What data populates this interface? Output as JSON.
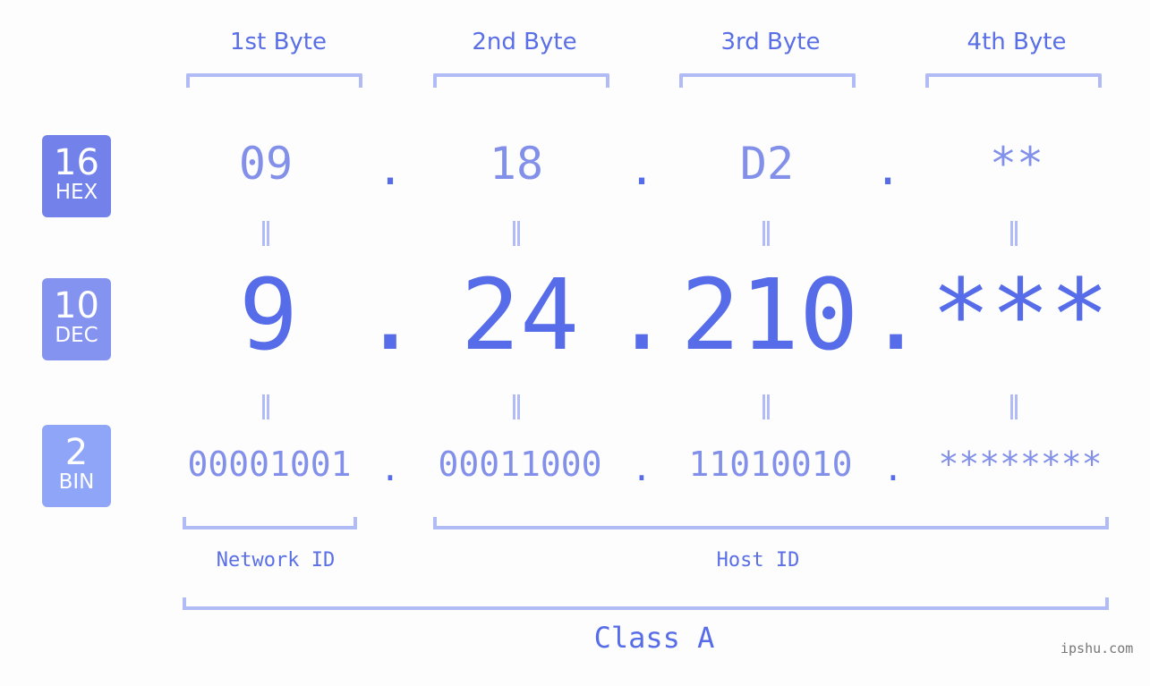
{
  "bytes": [
    {
      "label": "1st Byte",
      "hex": "09",
      "dec": "9",
      "bin": "00001001"
    },
    {
      "label": "2nd Byte",
      "hex": "18",
      "dec": "24",
      "bin": "00011000"
    },
    {
      "label": "3rd Byte",
      "hex": "D2",
      "dec": "210",
      "bin": "11010010"
    },
    {
      "label": "4th Byte",
      "hex": "**",
      "dec": "***",
      "bin": "********"
    }
  ],
  "separator": ".",
  "bases": {
    "hex": {
      "num": "16",
      "name": "HEX"
    },
    "dec": {
      "num": "10",
      "name": "DEC"
    },
    "bin": {
      "num": "2",
      "name": "BIN"
    }
  },
  "sections": {
    "network": "Network ID",
    "host": "Host ID",
    "class": "Class A"
  },
  "watermark": "ipshu.com",
  "colors": {
    "primary": "#566ce8",
    "light": "#8290ea",
    "bracket": "#b1bbf6",
    "hex_badge": "#7381ea",
    "dec_badge": "#8493ef",
    "bin_badge": "#8fa5f8"
  }
}
